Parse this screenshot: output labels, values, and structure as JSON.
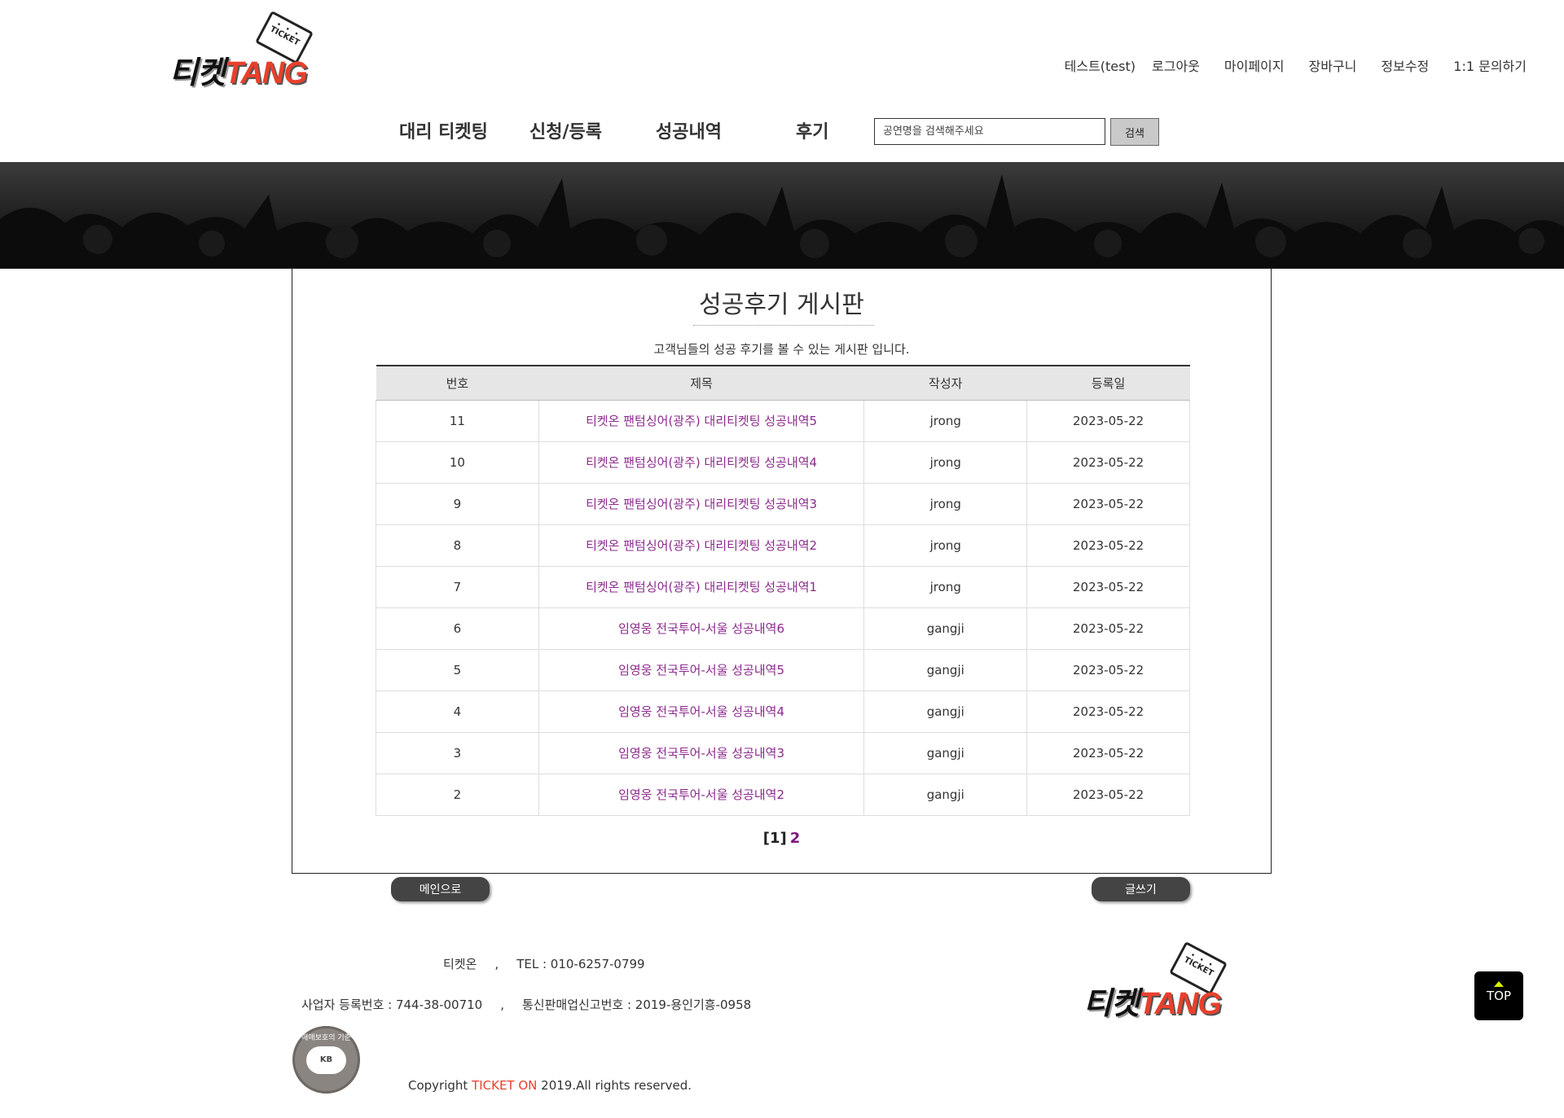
{
  "header": {
    "logo_left": "티켓",
    "logo_right": "TANG",
    "logo_ticket": "TICKET",
    "top_nav": [
      {
        "label": "테스트(test)"
      },
      {
        "label": "로그아웃"
      },
      {
        "label": "마이페이지"
      },
      {
        "label": "장바구니"
      },
      {
        "label": "정보수정"
      },
      {
        "label": "1:1 문의하기"
      }
    ],
    "main_nav": [
      {
        "label": "대리 티켓팅"
      },
      {
        "label": "신청/등록"
      },
      {
        "label": "성공내역"
      },
      {
        "label": "후기"
      }
    ],
    "search_placeholder": "공연명을 검색해주세요",
    "search_button": "검색"
  },
  "board": {
    "title": "성공후기 게시판",
    "description": "고객님들의 성공 후기를 볼 수 있는 게시판 입니다.",
    "columns": [
      "번호",
      "제목",
      "작성자",
      "등록일"
    ],
    "rows": [
      {
        "no": "11",
        "title": "티켓온 팬텀싱어(광주) 대리티켓팅 성공내역5",
        "author": "jrong",
        "date": "2023-05-22"
      },
      {
        "no": "10",
        "title": "티켓온 팬텀싱어(광주) 대리티켓팅 성공내역4",
        "author": "jrong",
        "date": "2023-05-22"
      },
      {
        "no": "9",
        "title": "티켓온 팬텀싱어(광주) 대리티켓팅 성공내역3",
        "author": "jrong",
        "date": "2023-05-22"
      },
      {
        "no": "8",
        "title": "티켓온 팬텀싱어(광주) 대리티켓팅 성공내역2",
        "author": "jrong",
        "date": "2023-05-22"
      },
      {
        "no": "7",
        "title": "티켓온 팬텀싱어(광주) 대리티켓팅 성공내역1",
        "author": "jrong",
        "date": "2023-05-22"
      },
      {
        "no": "6",
        "title": "임영웅 전국투어-서울 성공내역6",
        "author": "gangji",
        "date": "2023-05-22"
      },
      {
        "no": "5",
        "title": "임영웅 전국투어-서울 성공내역5",
        "author": "gangji",
        "date": "2023-05-22"
      },
      {
        "no": "4",
        "title": "임영웅 전국투어-서울 성공내역4",
        "author": "gangji",
        "date": "2023-05-22"
      },
      {
        "no": "3",
        "title": "임영웅 전국투어-서울 성공내역3",
        "author": "gangji",
        "date": "2023-05-22"
      },
      {
        "no": "2",
        "title": "임영웅 전국투어-서울 성공내역2",
        "author": "gangji",
        "date": "2023-05-22"
      }
    ],
    "pagination": {
      "current": "[1]",
      "next": "2"
    },
    "main_button": "메인으로",
    "write_button": "글쓰기"
  },
  "footer": {
    "company": "티켓온",
    "sep": ",",
    "tel": "TEL : 010-6257-0799",
    "biz_no": "사업자 등록번호 : 744-38-00710",
    "mail_order_no": "통신판매업신고번호 : 2019-용인기흥-0958",
    "copyright_prefix": "Copyright ",
    "copyright_brand": "TICKET ON",
    "copyright_suffix": " 2019.All rights reserved.",
    "seal_ring": "매매보호의 기준",
    "seal_center": "KB",
    "top_button": "TOP"
  },
  "colors": {
    "accent": "#e8402c",
    "link": "#8b2a8b",
    "button_dark": "#444444"
  }
}
